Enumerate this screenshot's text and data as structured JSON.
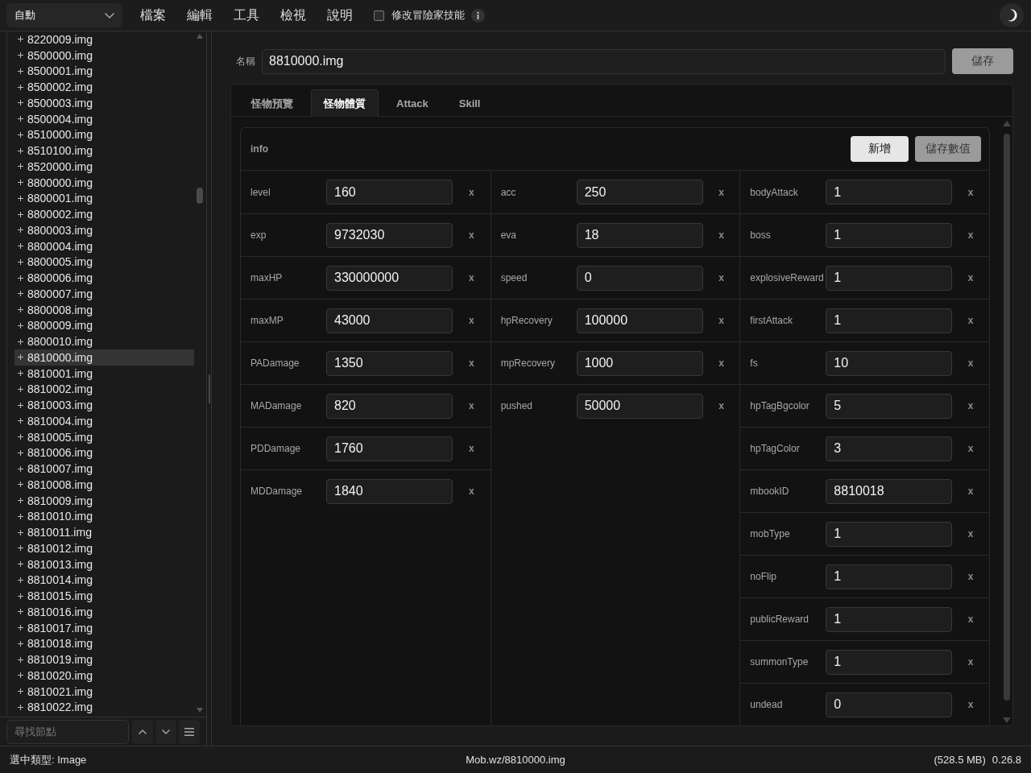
{
  "toolbar": {
    "mode_select": {
      "value": "自動"
    },
    "menu": [
      "檔案",
      "編輯",
      "工具",
      "檢視",
      "說明"
    ],
    "skill_checkbox": {
      "label": "修改冒險家技能",
      "checked": false
    }
  },
  "sidebar": {
    "items": [
      {
        "label": "8220009.img",
        "expanded": false,
        "selected": false
      },
      {
        "label": "8500000.img",
        "expanded": false,
        "selected": false
      },
      {
        "label": "8500001.img",
        "expanded": false,
        "selected": false
      },
      {
        "label": "8500002.img",
        "expanded": false,
        "selected": false
      },
      {
        "label": "8500003.img",
        "expanded": false,
        "selected": false
      },
      {
        "label": "8500004.img",
        "expanded": false,
        "selected": false
      },
      {
        "label": "8510000.img",
        "expanded": false,
        "selected": false
      },
      {
        "label": "8510100.img",
        "expanded": false,
        "selected": false
      },
      {
        "label": "8520000.img",
        "expanded": false,
        "selected": false
      },
      {
        "label": "8800000.img",
        "expanded": false,
        "selected": false
      },
      {
        "label": "8800001.img",
        "expanded": false,
        "selected": false
      },
      {
        "label": "8800002.img",
        "expanded": false,
        "selected": false
      },
      {
        "label": "8800003.img",
        "expanded": false,
        "selected": false
      },
      {
        "label": "8800004.img",
        "expanded": false,
        "selected": false
      },
      {
        "label": "8800005.img",
        "expanded": false,
        "selected": false
      },
      {
        "label": "8800006.img",
        "expanded": false,
        "selected": false
      },
      {
        "label": "8800007.img",
        "expanded": false,
        "selected": false
      },
      {
        "label": "8800008.img",
        "expanded": false,
        "selected": false
      },
      {
        "label": "8800009.img",
        "expanded": false,
        "selected": false
      },
      {
        "label": "8800010.img",
        "expanded": false,
        "selected": false
      },
      {
        "label": "8810000.img",
        "expanded": false,
        "selected": true
      },
      {
        "label": "8810001.img",
        "expanded": false,
        "selected": false
      },
      {
        "label": "8810002.img",
        "expanded": false,
        "selected": false
      },
      {
        "label": "8810003.img",
        "expanded": false,
        "selected": false
      },
      {
        "label": "8810004.img",
        "expanded": false,
        "selected": false
      },
      {
        "label": "8810005.img",
        "expanded": false,
        "selected": false
      },
      {
        "label": "8810006.img",
        "expanded": false,
        "selected": false
      },
      {
        "label": "8810007.img",
        "expanded": false,
        "selected": false
      },
      {
        "label": "8810008.img",
        "expanded": false,
        "selected": false
      },
      {
        "label": "8810009.img",
        "expanded": false,
        "selected": false
      },
      {
        "label": "8810010.img",
        "expanded": false,
        "selected": false
      },
      {
        "label": "8810011.img",
        "expanded": false,
        "selected": false
      },
      {
        "label": "8810012.img",
        "expanded": false,
        "selected": false
      },
      {
        "label": "8810013.img",
        "expanded": false,
        "selected": false
      },
      {
        "label": "8810014.img",
        "expanded": false,
        "selected": false
      },
      {
        "label": "8810015.img",
        "expanded": false,
        "selected": false
      },
      {
        "label": "8810016.img",
        "expanded": false,
        "selected": false
      },
      {
        "label": "8810017.img",
        "expanded": false,
        "selected": false
      },
      {
        "label": "8810018.img",
        "expanded": false,
        "selected": false
      },
      {
        "label": "8810019.img",
        "expanded": false,
        "selected": false
      },
      {
        "label": "8810020.img",
        "expanded": false,
        "selected": false
      },
      {
        "label": "8810021.img",
        "expanded": false,
        "selected": false
      },
      {
        "label": "8810022.img",
        "expanded": false,
        "selected": false
      }
    ],
    "search": {
      "placeholder": "尋找節點"
    }
  },
  "name_field": {
    "label": "名稱",
    "value": "8810000.img"
  },
  "save_button": {
    "label": "儲存",
    "disabled": true
  },
  "tabs": [
    {
      "label": "怪物預覽",
      "selected": false
    },
    {
      "label": "怪物體質",
      "selected": true
    },
    {
      "label": "Attack",
      "selected": false
    },
    {
      "label": "Skill",
      "selected": false
    }
  ],
  "section": {
    "title": "info",
    "buttons": [
      {
        "label": "新增",
        "disabled": false
      },
      {
        "label": "儲存數值",
        "disabled": true
      }
    ],
    "columns": [
      {
        "fields": [
          {
            "key": "level",
            "value": "160",
            "remove": "x"
          },
          {
            "key": "exp",
            "value": "9732030",
            "remove": "x"
          },
          {
            "key": "maxHP",
            "value": "330000000",
            "remove": "x"
          },
          {
            "key": "maxMP",
            "value": "43000",
            "remove": "x"
          },
          {
            "key": "PADamage",
            "value": "1350",
            "remove": "x"
          },
          {
            "key": "MADamage",
            "value": "820",
            "remove": "x"
          },
          {
            "key": "PDDamage",
            "value": "1760",
            "remove": "x"
          },
          {
            "key": "MDDamage",
            "value": "1840",
            "remove": "x"
          }
        ]
      },
      {
        "fields": [
          {
            "key": "acc",
            "value": "250",
            "remove": "x"
          },
          {
            "key": "eva",
            "value": "18",
            "remove": "x"
          },
          {
            "key": "speed",
            "value": "0",
            "remove": "x"
          },
          {
            "key": "hpRecovery",
            "value": "100000",
            "remove": "x"
          },
          {
            "key": "mpRecovery",
            "value": "1000",
            "remove": "x"
          },
          {
            "key": "pushed",
            "value": "50000",
            "remove": "x"
          }
        ]
      },
      {
        "fields": [
          {
            "key": "bodyAttack",
            "value": "1",
            "remove": "x"
          },
          {
            "key": "boss",
            "value": "1",
            "remove": "x"
          },
          {
            "key": "explosiveReward",
            "value": "1",
            "remove": "x"
          },
          {
            "key": "firstAttack",
            "value": "1",
            "remove": "x"
          },
          {
            "key": "fs",
            "value": "10",
            "remove": "x"
          },
          {
            "key": "hpTagBgcolor",
            "value": "5",
            "remove": "x"
          },
          {
            "key": "hpTagColor",
            "value": "3",
            "remove": "x"
          },
          {
            "key": "mbookID",
            "value": "8810018",
            "remove": "x"
          },
          {
            "key": "mobType",
            "value": "1",
            "remove": "x"
          },
          {
            "key": "noFlip",
            "value": "1",
            "remove": "x"
          },
          {
            "key": "publicReward",
            "value": "1",
            "remove": "x"
          },
          {
            "key": "summonType",
            "value": "1",
            "remove": "x"
          },
          {
            "key": "undead",
            "value": "0",
            "remove": "x"
          }
        ]
      }
    ]
  },
  "status_bar": {
    "selected_type": "選中類型: Image",
    "path": "Mob.wz/8810000.img",
    "memory": "(528.5 MB)",
    "version": "0.26.8"
  }
}
